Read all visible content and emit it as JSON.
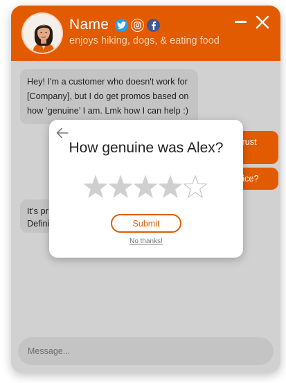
{
  "header": {
    "name": "Name",
    "tagline": "enjoys hiking, dogs, & eating food",
    "socials": [
      {
        "icon": "twitter-icon",
        "color": "#1da1f2"
      },
      {
        "icon": "instagram-icon",
        "color": "#ffffff"
      },
      {
        "icon": "facebook-icon",
        "color": "#3b5998"
      }
    ],
    "minimize_icon": "minimize-icon",
    "close_icon": "close-icon"
  },
  "messages": {
    "first": {
      "lines": [
        "Hey! I'm a customer who doesn't work for",
        "[Company], but I do get promos based on",
        "how ‘genuine’ I am. Lmk how I can help :)"
      ]
    },
    "out1": "trust",
    "out2": "rice?",
    "second": {
      "lines": [
        "It’s pr",
        "Defini"
      ]
    }
  },
  "input": {
    "placeholder": "Message..."
  },
  "rating_modal": {
    "title": "How genuine was Alex?",
    "rating": 4,
    "max_rating": 5,
    "submit_label": "Submit",
    "dismiss_label": "No thanks!"
  },
  "colors": {
    "accent": "#e35b00",
    "chat_bg": "#d1d1d1",
    "bubble_in": "#c4c4c4",
    "star_filled": "#cfcfcf",
    "star_empty_stroke": "#bdbdbd"
  }
}
